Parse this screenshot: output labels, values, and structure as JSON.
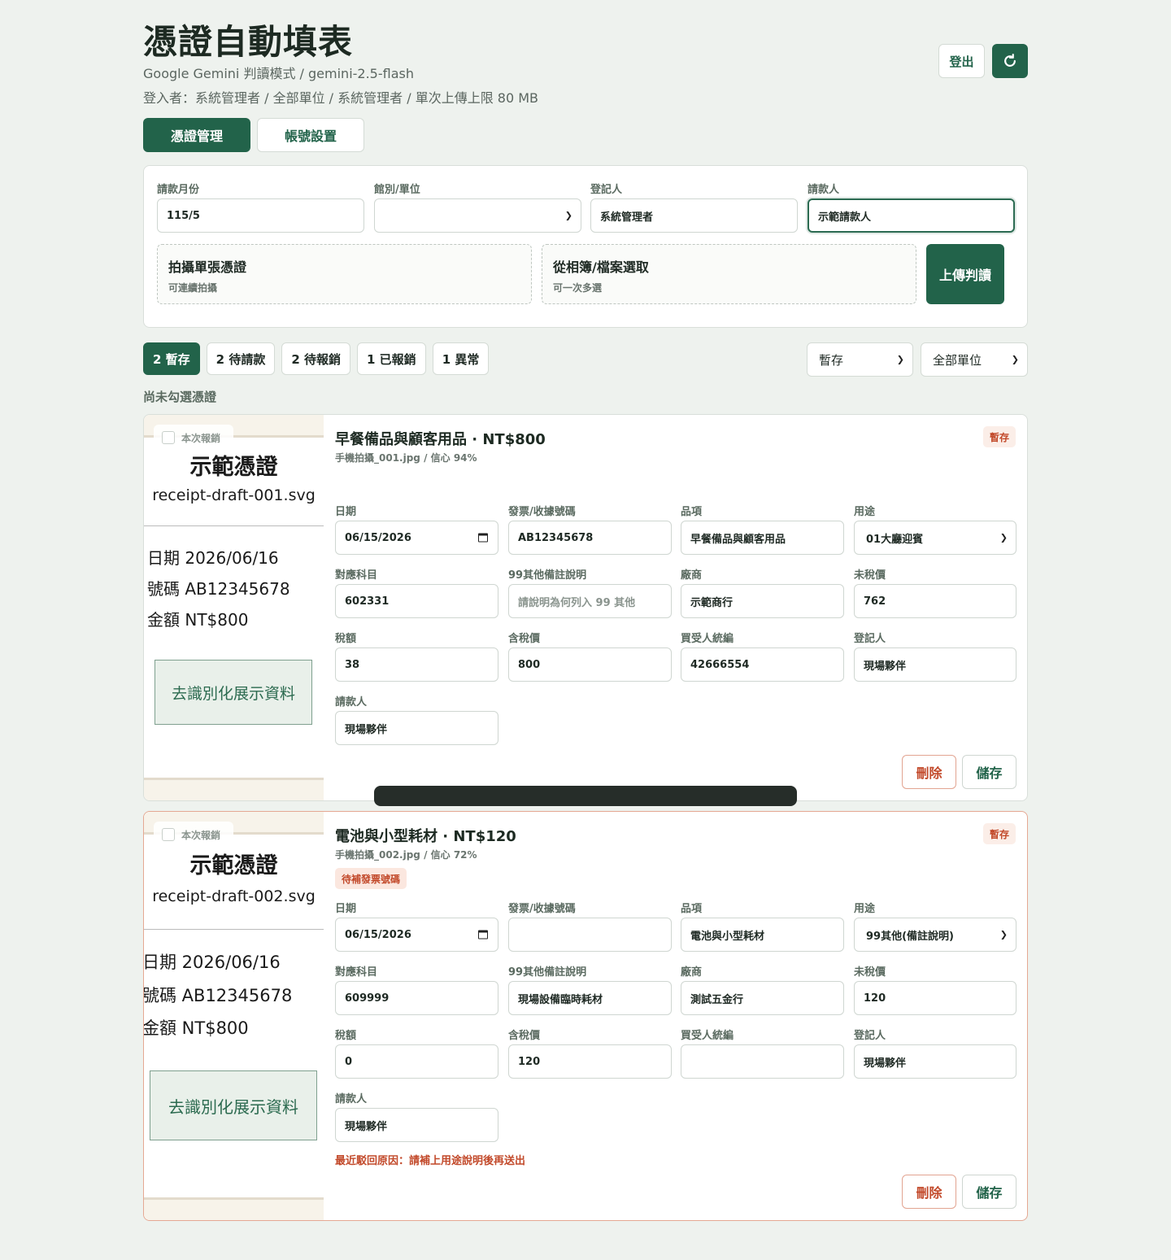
{
  "header": {
    "title": "憑證自動填表",
    "subtitle": "Google Gemini 判讀模式 / gemini-2.5-flash",
    "login_info": "登入者：系統管理者 / 全部單位 / 系統管理者 / 單次上傳上限 80 MB",
    "logout_label": "登出",
    "refresh_icon": "refresh-icon"
  },
  "tabs": [
    {
      "label": "憑證管理",
      "active": true
    },
    {
      "label": "帳號設置",
      "active": false
    }
  ],
  "upload_panel": {
    "month_label": "請款月份",
    "month_value": "115/5",
    "unit_label": "館別/單位",
    "unit_value": "",
    "registrar_label": "登記人",
    "registrar_value": "系統管理者",
    "requester_label": "請款人",
    "requester_value": "示範請款人",
    "camera_title": "拍攝單張憑證",
    "camera_sub": "可連續拍攝",
    "album_title": "從相簿/檔案選取",
    "album_sub": "可一次多選",
    "upload_label": "上傳判讀"
  },
  "status_chips": [
    {
      "label": "2 暫存",
      "active": true
    },
    {
      "label": "2 待請款",
      "active": false
    },
    {
      "label": "2 待報銷",
      "active": false
    },
    {
      "label": "1 已報銷",
      "active": false
    },
    {
      "label": "1 異常",
      "active": false
    }
  ],
  "filters": {
    "status_value": "暫存",
    "unit_value": "全部單位"
  },
  "selection_hint": "尚未勾選憑證",
  "field_labels": {
    "date": "日期",
    "invoice_no": "發票/收據號碼",
    "item": "品項",
    "purpose": "用途",
    "account": "對應科目",
    "other_note": "99其他備註說明",
    "vendor": "廠商",
    "pretax": "未稅價",
    "tax": "稅額",
    "total": "含稅價",
    "buyer_id": "買受人統編",
    "registrar": "登記人",
    "requester": "請款人"
  },
  "cards": [
    {
      "check_label": "本次報銷",
      "receipt_title": "示範憑證",
      "receipt_file": "receipt-draft-001.svg",
      "receipt_date": "日期 2026/06/16",
      "receipt_no": "號碼 AB12345678",
      "receipt_amount": "金額 NT$800",
      "receipt_box": "去識別化展示資料",
      "title": "早餐備品與顧客用品 · NT$800",
      "meta": "手機拍攝_001.jpg / 信心 94%",
      "badge": "暫存",
      "date": "06/15/2026",
      "invoice_no": "AB12345678",
      "item": "早餐備品與顧客用品",
      "purpose": "01大廳迎賓",
      "account": "602331",
      "other_note": "請說明為何列入 99 其他",
      "vendor": "示範商行",
      "pretax": "762",
      "tax": "38",
      "total": "800",
      "buyer_id": "42666554",
      "registrar": "現場夥伴",
      "requester": "現場夥伴",
      "delete_label": "刪除",
      "save_label": "儲存"
    },
    {
      "check_label": "本次報銷",
      "receipt_title": "示範憑證",
      "receipt_file": "receipt-draft-002.svg",
      "receipt_date": "日期 2026/06/16",
      "receipt_no": "號碼 AB12345678",
      "receipt_amount": "金額 NT$800",
      "receipt_box": "去識別化展示資料",
      "title": "電池與小型耗材 · NT$120",
      "meta": "手機拍攝_002.jpg / 信心 72%",
      "badge": "暫存",
      "warning_tag": "待補發票號碼",
      "date": "06/15/2026",
      "invoice_no": "",
      "item": "電池與小型耗材",
      "purpose": "99其他(備註說明)",
      "account": "609999",
      "other_note": "現場設備臨時耗材",
      "vendor": "測試五金行",
      "pretax": "120",
      "tax": "0",
      "total": "120",
      "buyer_id": "",
      "registrar": "現場夥伴",
      "requester": "現場夥伴",
      "reject_reason": "最近駁回原因：請補上用途說明後再送出",
      "delete_label": "刪除",
      "save_label": "儲存"
    }
  ]
}
